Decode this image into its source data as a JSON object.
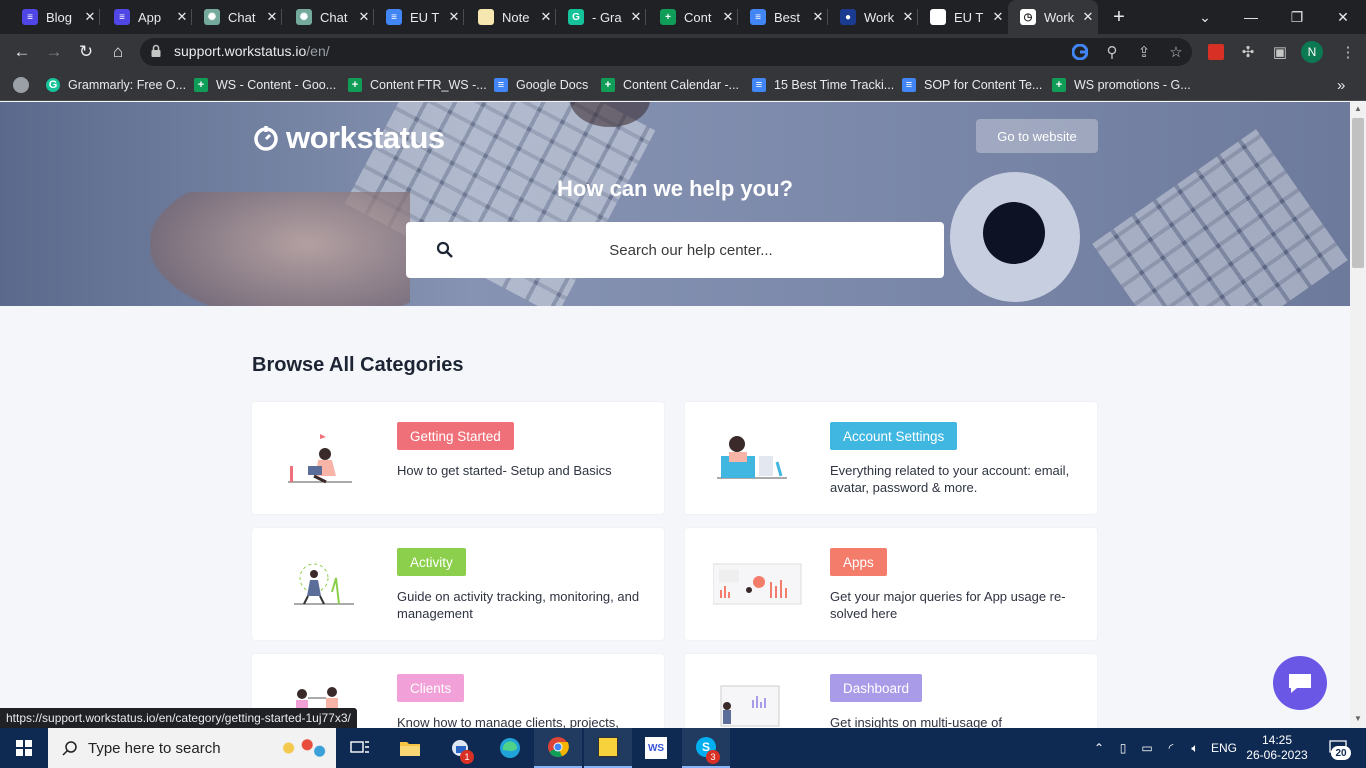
{
  "browser": {
    "tabs": [
      {
        "title": "Blog",
        "color": "#4f46e5",
        "glyph": "≡"
      },
      {
        "title": "App",
        "color": "#4f46e5",
        "glyph": "≡"
      },
      {
        "title": "Chat",
        "color": "#74aa9c",
        "glyph": "✺"
      },
      {
        "title": "Chat",
        "color": "#74aa9c",
        "glyph": "✺"
      },
      {
        "title": "EU T",
        "color": "#4285f4",
        "glyph": "≡"
      },
      {
        "title": "Note",
        "color": "#f6e7b0",
        "glyph": ""
      },
      {
        "title": "- Gra",
        "color": "#15c39a",
        "glyph": "G"
      },
      {
        "title": "Cont",
        "color": "#0f9d58",
        "glyph": "+"
      },
      {
        "title": "Best",
        "color": "#4285f4",
        "glyph": "≡"
      },
      {
        "title": "Work",
        "color": "#1a3b8f",
        "glyph": "●"
      },
      {
        "title": "EU T",
        "color": "#ffffff",
        "glyph": ""
      },
      {
        "title": "Work",
        "color": "#ffffff",
        "glyph": "◷"
      }
    ],
    "new_tab": "+",
    "url_host": "support.workstatus.io",
    "url_path": "/en/",
    "profile_initial": "N",
    "bookmarks": [
      {
        "label": "Grammarly: Free O...",
        "color": "#15c39a",
        "glyph": "G"
      },
      {
        "label": "WS - Content - Goo...",
        "color": "#0f9d58",
        "glyph": "+"
      },
      {
        "label": "Content FTR_WS -...",
        "color": "#0f9d58",
        "glyph": "+"
      },
      {
        "label": "Google Docs",
        "color": "#4285f4",
        "glyph": "≡"
      },
      {
        "label": "Content Calendar -...",
        "color": "#0f9d58",
        "glyph": "+"
      },
      {
        "label": "15 Best Time Tracki...",
        "color": "#4285f4",
        "glyph": "≡"
      },
      {
        "label": "SOP for Content Te...",
        "color": "#4285f4",
        "glyph": "≡"
      },
      {
        "label": "WS promotions - G...",
        "color": "#0f9d58",
        "glyph": "+"
      }
    ],
    "bookmarks_more": "»",
    "status_url": "https://support.workstatus.io/en/category/getting-started-1uj77x3/"
  },
  "page": {
    "logo": "workstatus",
    "go_to_website": "Go to website",
    "hero_title": "How can we help you?",
    "search_placeholder": "Search our help center...",
    "browse_title": "Browse All Categories",
    "categories": [
      {
        "name": "Getting Started",
        "color": "#f0707a",
        "desc": "How to get started- Setup and Basics"
      },
      {
        "name": "Account Settings",
        "color": "#3fb7e0",
        "desc": "Everything related to your account: email, avatar, password & more."
      },
      {
        "name": "Activity",
        "color": "#8ccf4d",
        "desc": "Guide on activity tracking, monitoring, and management"
      },
      {
        "name": "Apps",
        "color": "#f47c6b",
        "desc": "Get your major queries for App usage re- solved here"
      },
      {
        "name": "Clients",
        "color": "#f2a0d8",
        "desc": "Know how to manage clients, projects,"
      },
      {
        "name": "Dashboard",
        "color": "#a99be8",
        "desc": "Get insights on multi-usage of"
      }
    ]
  },
  "taskbar": {
    "search_placeholder": "Type here to search",
    "lang": "ENG",
    "time": "14:25",
    "date": "26-06-2023",
    "notif_count": "20",
    "outlook_badge": "1",
    "skype_badge": "3"
  }
}
